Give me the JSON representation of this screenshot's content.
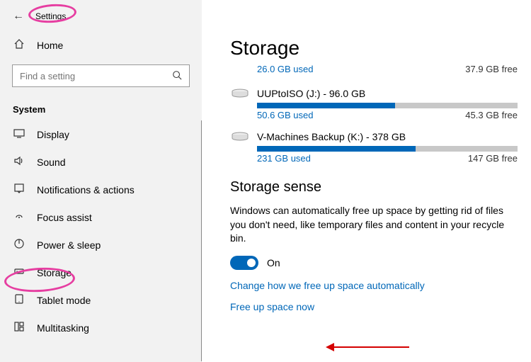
{
  "header": {
    "title": "Settings"
  },
  "sidebar": {
    "home_label": "Home",
    "search_placeholder": "Find a setting",
    "section_label": "System",
    "items": [
      {
        "label": "Display"
      },
      {
        "label": "Sound"
      },
      {
        "label": "Notifications & actions"
      },
      {
        "label": "Focus assist"
      },
      {
        "label": "Power & sleep"
      },
      {
        "label": "Storage"
      },
      {
        "label": "Tablet mode"
      },
      {
        "label": "Multitasking"
      }
    ]
  },
  "main": {
    "title": "Storage",
    "primary": {
      "used": "26.0 GB used",
      "free": "37.9 GB free"
    },
    "drives": [
      {
        "label": "UUPtoISO (J:) - 96.0 GB",
        "used": "50.6 GB used",
        "free": "45.3 GB free",
        "fill_pct": 53
      },
      {
        "label": "V-Machines Backup (K:) - 378 GB",
        "used": "231 GB used",
        "free": "147 GB free",
        "fill_pct": 61
      }
    ],
    "sense": {
      "title": "Storage sense",
      "desc": "Windows can automatically free up space by getting rid of files you don't need, like temporary files and content in your recycle bin.",
      "toggle_state": "On",
      "link1": "Change how we free up space automatically",
      "link2": "Free up space now"
    }
  }
}
